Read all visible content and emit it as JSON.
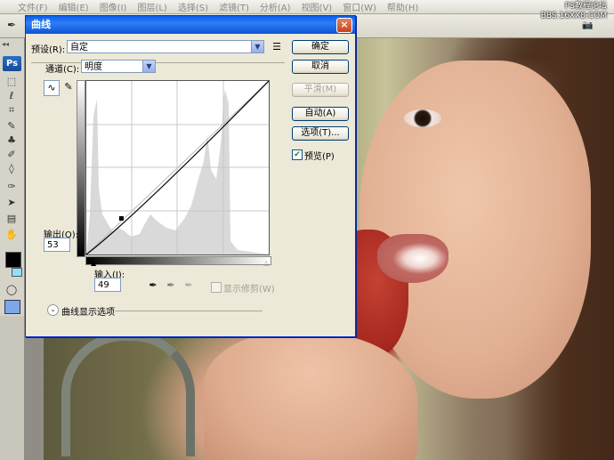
{
  "menubar": {
    "items": [
      "文件(F)",
      "编辑(E)",
      "图像(I)",
      "图层(L)",
      "选择(S)",
      "滤镜(T)",
      "分析(A)",
      "视图(V)",
      "窗口(W)",
      "帮助(H)"
    ]
  },
  "toolbox": {
    "logo": "Ps"
  },
  "watermark": {
    "line1": "PS教程论坛",
    "line2": "BBS.16XX8.COM"
  },
  "dialog": {
    "title": "曲线",
    "close_icon": "×",
    "preset_label": "预设(R):",
    "preset_value": "自定",
    "channel_label": "通道(C):",
    "channel_value": "明度",
    "output_label": "输出(O):",
    "output_value": "53",
    "input_label": "输入(I):",
    "input_value": "49",
    "buttons": {
      "ok": "确定",
      "cancel": "取消",
      "smooth": "平滑(M)",
      "auto": "自动(A)",
      "options": "选项(T)..."
    },
    "preview_label": "预览(P)",
    "preview_checked": true,
    "show_clipping_label": "显示修剪(W)",
    "show_clipping_checked": false,
    "curve_display_options": "曲线显示选项",
    "curve_point": {
      "input": 49,
      "output": 53
    }
  }
}
